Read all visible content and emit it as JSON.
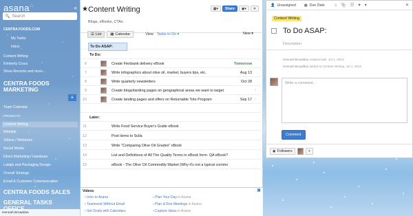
{
  "brand": {
    "logo": "asana",
    "collapse": "«"
  },
  "search": {
    "placeholder": "Search"
  },
  "sidebar": {
    "org1": "CENTRA FOODS.COM",
    "my_tasks": "My Tasks",
    "inbox": "Inbox",
    "items1": [
      "Content Writing",
      "Kimberly Cross",
      "Show Recents and more..."
    ],
    "org2": "CENTRA FOODS MARKETING",
    "team_calendar": "Team Calendar",
    "projects_label": "PROJECTS",
    "projects": [
      "Content Writing",
      "Website",
      "Videos / Webinars",
      "Social Media",
      "Direct Marketing / Handouts",
      "Labels and Packaging Design",
      "Overall Strategy",
      "Email & Customer Communication"
    ],
    "org3": "CENTRA FOODS SALES",
    "org4": "GENERAL TASKS OFFICE",
    "user": "Hennah Broaddus"
  },
  "project": {
    "title": "Content Writing",
    "description": "Blogs, eBooks, CTAs",
    "share": "Share",
    "views": {
      "list": "List",
      "calendar": "Calendar"
    },
    "view_label": "View",
    "view_value": "Tasks to Do",
    "new": "New"
  },
  "tasks": [
    {
      "num": "",
      "section": "To Do ASAP:",
      "selected": true
    },
    {
      "num": "",
      "section": "To Do:"
    },
    {
      "num": "6",
      "name": "Create Flexbank delivery eBook",
      "due": "Tomorrow",
      "due_color": "#2a9a2a",
      "avatar": true
    },
    {
      "num": "7",
      "name": "Write infographics about olive oil, market, buyers tips, etc.",
      "due": "Aug 13",
      "avatar": true
    },
    {
      "num": "8",
      "name": "Write quarterly newsletters",
      "due": "Oct 28",
      "avatar": true
    },
    {
      "num": "9",
      "name": "Create blogs/landing pages on geographical areas we want to target",
      "due": "",
      "avatar": true,
      "arrow": true
    },
    {
      "num": "10",
      "name": "Create landing pages and offers on Returnable Tote Program",
      "due": "Sep 17",
      "avatar": true,
      "arrow": true
    },
    {
      "num": "",
      "section": ""
    },
    {
      "num": "",
      "section": "Later:"
    },
    {
      "num": "11",
      "name": "Write Food Service Buyer's Guide eBook",
      "due": ""
    },
    {
      "num": "12",
      "name": "Post items to Sulla",
      "due": ""
    },
    {
      "num": "13",
      "name": "Write \"Comparing Olive Oil Grades\" eBook",
      "due": ""
    },
    {
      "num": "14",
      "name": "List and Definitions of All The Quality Terms in eBook form- QA eBook?",
      "due": ""
    },
    {
      "num": "15",
      "name": "eBook - The Olive Oil Commodity Market (Why it's not a typical commo",
      "due": ""
    }
  ],
  "videos": {
    "title": "Videos",
    "close": "✖",
    "col1": [
      {
        "label": "Intro to Asana",
        "src": ""
      },
      {
        "label": "Teamwork Without Email",
        "src": ""
      },
      {
        "label": "Set Goals with Calendars",
        "src": ""
      }
    ],
    "col2": [
      {
        "label": "Plan Your Day",
        "src": "in Asana"
      },
      {
        "label": "Plan & Run Meetings",
        "src": "in Asana"
      },
      {
        "label": "Capture Ideas",
        "src": "in Asana"
      }
    ]
  },
  "detail": {
    "assignee": "Unassigned",
    "due": "Due Date",
    "tag": "Content Writing",
    "title": "To Do ASAP:",
    "description_placeholder": "Description",
    "activity": [
      {
        "who": "Hennah Broaddus",
        "what": "created task.",
        "when": "Jul 1, 2013"
      },
      {
        "who": "Hennah Broaddus",
        "what": "added to Content Writing.",
        "when": "Jul 1, 2013"
      }
    ],
    "comment_placeholder": "Write a comment...",
    "comment_button": "Comment",
    "followers": "Followers",
    "add": "+"
  },
  "colors": {
    "accent": "#3d7ccf",
    "tag": "#fbe775",
    "tomorrow": "#2a9a2a"
  }
}
